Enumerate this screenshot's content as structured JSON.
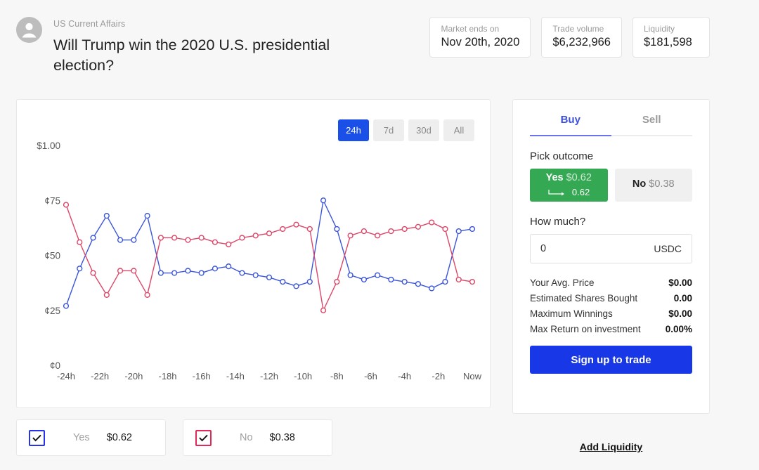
{
  "header": {
    "category": "US Current Affairs",
    "title": "Will Trump win the 2020 U.S. presidential election?",
    "avatar_icon": "user-avatar-icon",
    "stats": [
      {
        "label": "Market ends on",
        "value": "Nov 20th, 2020"
      },
      {
        "label": "Trade volume",
        "value": "$6,232,966"
      },
      {
        "label": "Liquidity",
        "value": "$181,598"
      }
    ]
  },
  "chart_panel": {
    "ranges": [
      {
        "label": "24h",
        "active": true
      },
      {
        "label": "7d",
        "active": false
      },
      {
        "label": "30d",
        "active": false
      },
      {
        "label": "All",
        "active": false
      }
    ]
  },
  "chart_data": {
    "type": "line",
    "title": "",
    "xlabel": "",
    "ylabel": "",
    "grid": false,
    "legend_position": "below-card",
    "ylim": [
      0,
      100
    ],
    "ytick_labels": [
      "$1.00",
      "¢75",
      "¢50",
      "¢25",
      "¢0"
    ],
    "ytick_values": [
      100,
      75,
      50,
      25,
      0
    ],
    "xtick_labels": [
      "-24h",
      "-22h",
      "-20h",
      "-18h",
      "-16h",
      "-14h",
      "-12h",
      "-10h",
      "-8h",
      "-6h",
      "-4h",
      "-2h",
      "Now"
    ],
    "x": [
      -24,
      -23.2,
      -22.4,
      -21.6,
      -20.8,
      -20,
      -19.2,
      -18.4,
      -17.6,
      -16.8,
      -16,
      -15.2,
      -14.4,
      -13.6,
      -12.8,
      -12,
      -11.2,
      -10.4,
      -9.6,
      -8.8,
      -8,
      -7.2,
      -6.4,
      -5.6,
      -4.8,
      -4,
      -3.2,
      -2.4,
      -1.6,
      -0.8,
      0
    ],
    "series": [
      {
        "name": "Yes",
        "color": "#3b55d9",
        "values": [
          27,
          44,
          58,
          68,
          57,
          57,
          68,
          42,
          42,
          43,
          42,
          44,
          45,
          42,
          41,
          40,
          38,
          36,
          38,
          75,
          62,
          41,
          39,
          41,
          39,
          38,
          37,
          35,
          38,
          61,
          62
        ]
      },
      {
        "name": "No",
        "color": "#dc4668",
        "values": [
          73,
          56,
          42,
          32,
          43,
          43,
          32,
          58,
          58,
          57,
          58,
          56,
          55,
          58,
          59,
          60,
          62,
          64,
          62,
          25,
          38,
          59,
          61,
          59,
          61,
          62,
          63,
          65,
          62,
          39,
          38
        ]
      }
    ]
  },
  "trade_panel": {
    "tabs": [
      {
        "label": "Buy",
        "active": true
      },
      {
        "label": "Sell",
        "active": false
      }
    ],
    "pick_outcome_label": "Pick outcome",
    "outcomes": {
      "yes": {
        "name": "Yes",
        "price": "$0.62",
        "detail": "0.62",
        "selected": true
      },
      "no": {
        "name": "No",
        "price": "$0.38",
        "selected": false
      }
    },
    "how_much_label": "How much?",
    "amount": {
      "value": "0",
      "placeholder": "0",
      "unit": "USDC"
    },
    "summary": [
      {
        "label": "Your Avg. Price",
        "value": "$0.00"
      },
      {
        "label": "Estimated Shares Bought",
        "value": "0.00"
      },
      {
        "label": "Maximum Winnings",
        "value": "$0.00"
      },
      {
        "label": "Max Return on investment",
        "value": "0.00%"
      }
    ],
    "signup_label": "Sign up to trade",
    "add_liquidity_label": "Add Liquidity"
  },
  "legend": [
    {
      "name": "Yes",
      "price": "$0.62",
      "checked": true,
      "color": "#2633e8"
    },
    {
      "name": "No",
      "price": "$0.38",
      "checked": true,
      "color": "#e02957"
    }
  ]
}
